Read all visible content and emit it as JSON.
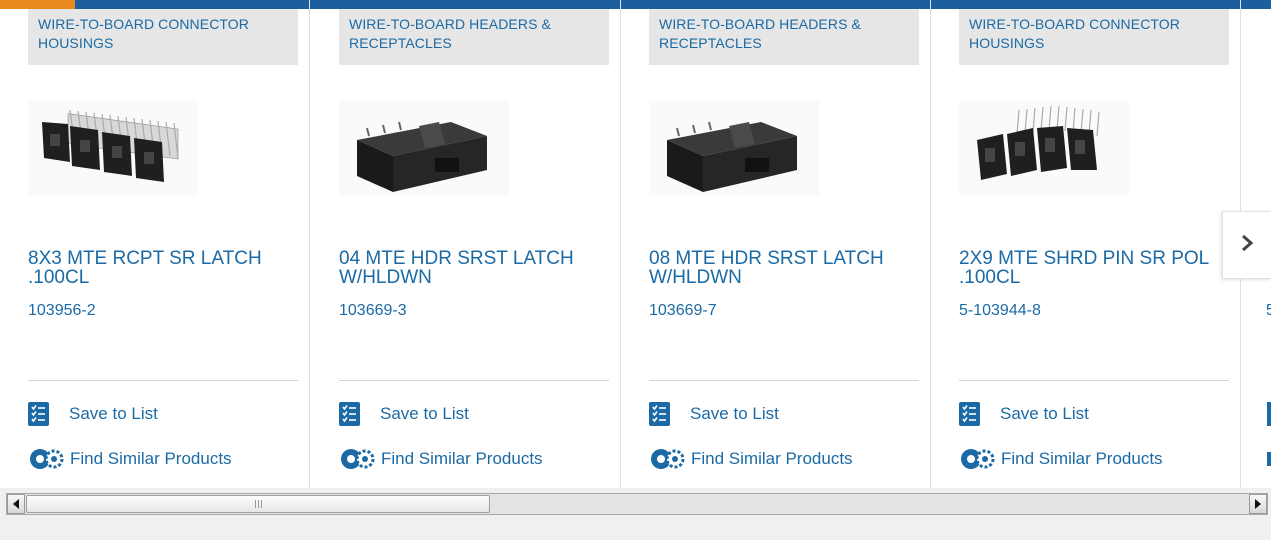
{
  "carousel": {
    "products": [
      {
        "category": "WIRE-TO-BOARD CONNECTOR HOUSINGS",
        "title": "8X3 MTE RCPT SR LATCH .100CL",
        "part_number": "103956-2",
        "save_label": "Save to List",
        "similar_label": "Find Similar Products",
        "image": "receptacle-housing-strip"
      },
      {
        "category": "WIRE-TO-BOARD HEADERS & RECEPTACLES",
        "title": "04 MTE HDR SRST LATCH W/HLDWN",
        "part_number": "103669-3",
        "save_label": "Save to List",
        "similar_label": "Find Similar Products",
        "image": "header-block"
      },
      {
        "category": "WIRE-TO-BOARD HEADERS & RECEPTACLES",
        "title": "08 MTE HDR SRST LATCH W/HLDWN",
        "part_number": "103669-7",
        "save_label": "Save to List",
        "similar_label": "Find Similar Products",
        "image": "header-block"
      },
      {
        "category": "WIRE-TO-BOARD CONNECTOR HOUSINGS",
        "title": "2X9 MTE SHRD PIN SR POL .100CL",
        "part_number": "5-103944-8",
        "save_label": "Save to List",
        "similar_label": "Find Similar Products",
        "image": "shrouded-pin-strip"
      }
    ],
    "next_arrow": "chevron-right-icon",
    "peek_part_number": "5"
  },
  "colors": {
    "accent_blue": "#1b6aa5",
    "top_bar": "#1b5f9e",
    "top_accent": "#e8891d"
  },
  "scrollbar": {
    "position_fraction": 0.37
  }
}
